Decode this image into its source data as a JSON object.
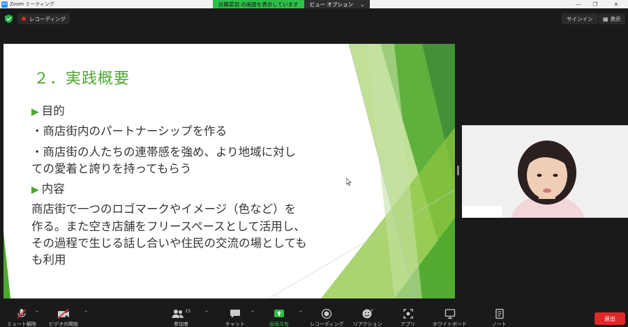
{
  "window": {
    "app_title": "Zoom ミーティング",
    "logo_text": "zm"
  },
  "share_banner": {
    "status": "近藤菜羽 の画面を表示しています",
    "view_options": "ビュー オプション"
  },
  "top": {
    "recording": "レコーディング",
    "sign_in": "サインイン",
    "view": "表示"
  },
  "slide": {
    "title": "２．実践概要",
    "lines": [
      "目的",
      "・商店街内のパートナーシップを作る",
      "・商店街の人たちの連帯感を強め、より地域に対し",
      "ての愛着と誇りを持ってもらう",
      "内容",
      "商店街で一つのロゴマークやイメージ（色など）を",
      "作る。また空き店舗をフリースペースとして活用し、",
      "その過程で生じる話し合いや住民の交流の場としても",
      "も利用"
    ]
  },
  "toolbar": {
    "unmute": "ミュート解除",
    "start_video": "ビデオの開始",
    "participants": "参加者",
    "participant_count": "15",
    "chat": "チャット",
    "share_screen": "画面共有",
    "record": "レコーディング",
    "reactions": "リアクション",
    "apps": "アプリ",
    "whiteboard": "ホワイトボード",
    "notes": "ノート",
    "leave": "退出"
  },
  "colors": {
    "accent_green": "#4ea72e",
    "share_green": "#2fbe4a",
    "leave_red": "#e02828"
  }
}
